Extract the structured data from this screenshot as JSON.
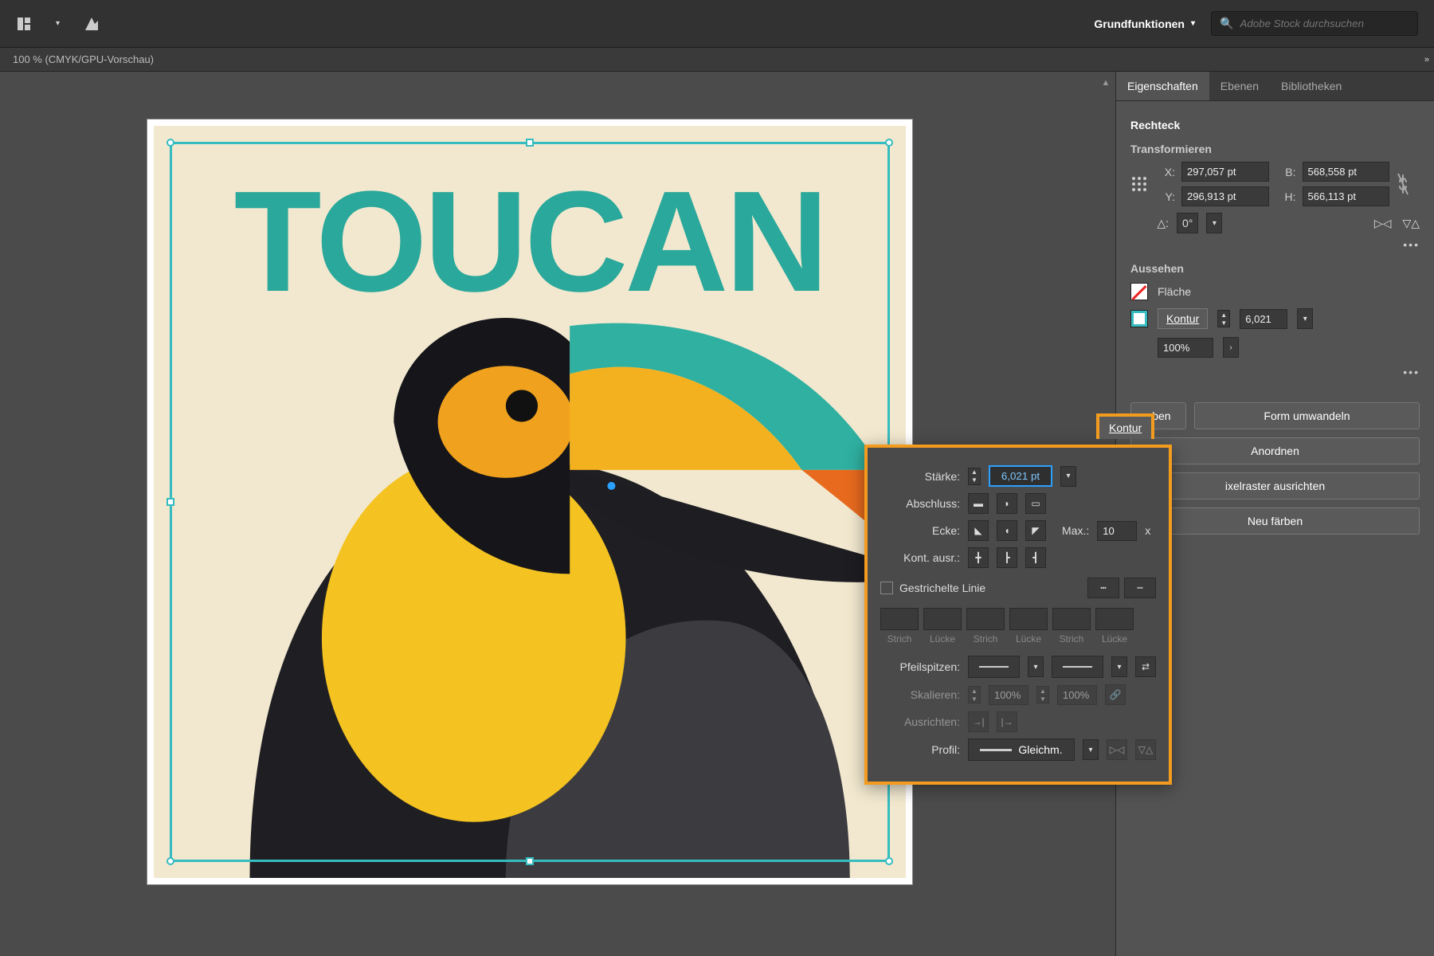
{
  "topbar": {
    "workspace": "Grundfunktionen",
    "search_placeholder": "Adobe Stock durchsuchen"
  },
  "document_tab": "100 % (CMYK/GPU-Vorschau)",
  "artwork": {
    "title": "TOUCAN"
  },
  "panels": {
    "tabs": [
      "Eigenschaften",
      "Ebenen",
      "Bibliotheken"
    ],
    "active_tab": "Eigenschaften",
    "object_type": "Rechteck",
    "transform": {
      "heading": "Transformieren",
      "x_label": "X:",
      "x": "297,057 pt",
      "y_label": "Y:",
      "y": "296,913 pt",
      "w_label": "B:",
      "w": "568,558 pt",
      "h_label": "H:",
      "h": "566,113 pt",
      "angle_icon": "△:",
      "angle": "0°"
    },
    "appearance": {
      "heading": "Aussehen",
      "fill_label": "Fläche",
      "stroke_label": "Kontur",
      "stroke_weight": "6,021",
      "opacity": "100%"
    },
    "quick_actions": {
      "col2": "Form umwandeln",
      "arrange": "Anordnen",
      "pixel_align": "ixelraster ausrichten",
      "recolor": "Neu färben",
      "hidden_left": "eben"
    }
  },
  "stroke_popout": {
    "weight_label": "Stärke:",
    "weight_value": "6,021 pt",
    "cap_label": "Abschluss:",
    "corner_label": "Ecke:",
    "limit_label": "Max.:",
    "limit_value": "10",
    "limit_suffix": "x",
    "align_label": "Kont. ausr.:",
    "dashed_label": "Gestrichelte Linie",
    "dash_labels": [
      "Strich",
      "Lücke",
      "Strich",
      "Lücke",
      "Strich",
      "Lücke"
    ],
    "arrow_label": "Pfeilspitzen:",
    "scale_label": "Skalieren:",
    "scale_val": "100%",
    "align_arrow_label": "Ausrichten:",
    "profile_label": "Profil:",
    "profile_value": "Gleichm."
  }
}
